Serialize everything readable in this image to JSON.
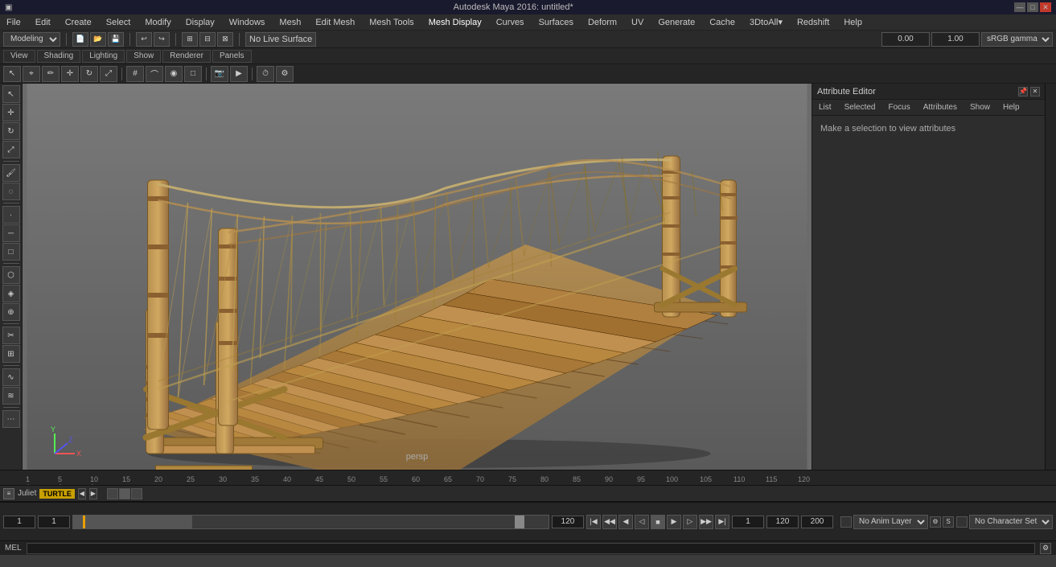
{
  "titlebar": {
    "title": "Autodesk Maya 2016: untitled*",
    "win_min": "—",
    "win_max": "□",
    "win_close": "✕"
  },
  "menubar": {
    "items": [
      "File",
      "Edit",
      "Create",
      "Select",
      "Modify",
      "Display",
      "Windows",
      "Mesh",
      "Edit Mesh",
      "Mesh Tools",
      "Mesh Display",
      "Curves",
      "Surfaces",
      "Deform",
      "UV",
      "Generate",
      "Cache",
      "3DtoAll▾",
      "Redshift",
      "Help"
    ]
  },
  "toolbar": {
    "mode_label": "Modeling",
    "no_live": "No Live Surface",
    "channel_input": "0.00",
    "time_input": "1.00",
    "gamma_label": "sRGB gamma"
  },
  "toolbar2": {
    "tabs": [
      "View",
      "Shading",
      "Lighting",
      "Show",
      "Renderer",
      "Panels"
    ]
  },
  "viewport": {
    "label": "persp"
  },
  "attr_editor": {
    "title": "Attribute Editor",
    "tabs": [
      "List",
      "Selected",
      "Focus",
      "Attributes",
      "Show",
      "Help"
    ],
    "message": "Make a selection to view attributes"
  },
  "timeline": {
    "ticks": [
      "1",
      "5",
      "10",
      "15",
      "20",
      "25",
      "30",
      "35",
      "40",
      "45",
      "50",
      "55",
      "60",
      "65",
      "70",
      "75",
      "80",
      "85",
      "90",
      "95",
      "100",
      "105",
      "110",
      "115",
      "120"
    ],
    "char_label": "Juliet",
    "turtle_btn": "TURTLE",
    "start_frame": "1",
    "end_frame": "1",
    "range_end": "120",
    "anim_start": "1",
    "anim_end": "120",
    "current_frame": "1",
    "range_out": "200",
    "anim_layer": "No Anim Layer",
    "char_set": "No Character Set"
  },
  "mel_bar": {
    "label": "MEL",
    "placeholder": ""
  }
}
